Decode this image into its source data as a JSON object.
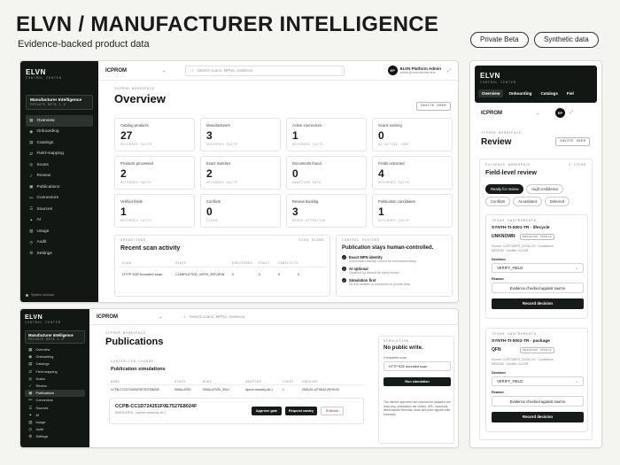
{
  "hero": {
    "title": "ELVN / MANUFACTURER INTELLIGENCE",
    "subtitle": "Evidence-backed product data",
    "pills": [
      "Private Beta",
      "Synthetic data"
    ]
  },
  "brand": {
    "name": "ELVN",
    "sub": "CONTROL CENTER"
  },
  "workspace": {
    "title": "Manufacturer Intelligence",
    "sub": "PRIVATE BETA 1.2"
  },
  "nav": [
    {
      "label": "Overview",
      "icon": "▦"
    },
    {
      "label": "Onboarding",
      "icon": "◉"
    },
    {
      "label": "Catalogs",
      "icon": "▤"
    },
    {
      "label": "Field-mapping",
      "icon": "⇄"
    },
    {
      "label": "Scans",
      "icon": "◎"
    },
    {
      "label": "Review",
      "icon": "✓"
    },
    {
      "label": "Publications",
      "icon": "▣"
    },
    {
      "label": "Connectors",
      "icon": "⚯"
    },
    {
      "label": "Sources",
      "icon": "☰"
    },
    {
      "label": "AI",
      "icon": "✦"
    },
    {
      "label": "Usage",
      "icon": "▥"
    },
    {
      "label": "Audit",
      "icon": "◷"
    },
    {
      "label": "Settings",
      "icon": "⚙"
    }
  ],
  "footer": {
    "status": "System nominal"
  },
  "topbar": {
    "workspace": "ICPROM",
    "search_placeholder": "Search scans, MPNs, evidence",
    "user_initials": "EP",
    "user_name": "ELVN Platform Admin",
    "user_email": "admin@controlcenter.test"
  },
  "overview": {
    "eyebrow": "ICPROM WORKSPACE",
    "title": "Overview",
    "action": "INVITE USER",
    "cards": [
      {
        "label": "Catalog products",
        "value": "27",
        "meta": "RECORDED FACTS"
      },
      {
        "label": "Manufacturers",
        "value": "3",
        "meta": "RECORDED FACTS"
      },
      {
        "label": "Active connectors",
        "value": "1",
        "meta": "RECORDED FACTS"
      },
      {
        "label": "Scans running",
        "value": "0",
        "meta": "NO ACTIVE JOBS"
      },
      {
        "label": "Products processed",
        "value": "2",
        "meta": "RECORDED FACTS"
      },
      {
        "label": "Exact matches",
        "value": "2",
        "meta": "RECORDED FACTS"
      },
      {
        "label": "Documents found",
        "value": "0",
        "meta": "AWAITING DATA"
      },
      {
        "label": "Fields extracted",
        "value": "4",
        "meta": "RECORDED FACTS"
      },
      {
        "label": "Verified fields",
        "value": "1",
        "meta": "RECORDED FACTS"
      },
      {
        "label": "Conflicts",
        "value": "0",
        "meta": "CLEAR"
      },
      {
        "label": "Review backlog",
        "value": "3",
        "meta": "NEEDS ATTENTION"
      },
      {
        "label": "Publication candidates",
        "value": "1",
        "meta": "RECORDED FACTS"
      }
    ],
    "ops": {
      "eyebrow": "OPERATIONS",
      "title": "Recent scan activity",
      "action": "VIEW SCANS",
      "headers": [
        "SCAN",
        "STATE",
        "PROCESSED",
        "EXACT",
        "CONFLICTS"
      ],
      "row": [
        "HTTP E2E bounded scan",
        "COMPLETED_WITH_REVIEW",
        "2",
        "2",
        "0",
        "2"
      ]
    },
    "control": {
      "eyebrow": "CONTROL POSTURE",
      "title": "Publication stays human-controlled.",
      "items": [
        {
          "title": "Exact MPN identity",
          "desc": "Unbounded identity cannot be normalized away."
        },
        {
          "title": "AI optional",
          "desc": "Disabled by default for every tenant."
        },
        {
          "title": "Simulation first",
          "desc": "No live adapter is connected in private beta."
        }
      ]
    }
  },
  "publications": {
    "eyebrow": "ICPROM WORKSPACE",
    "title": "Publications",
    "sim": {
      "eyebrow": "CONTROLLED CHANGE",
      "title": "Publication simulations",
      "headers": [
        "NAME",
        "STATE",
        "MODE",
        "ADAPTER",
        "COUNT",
        "CREATED"
      ],
      "row": [
        "CCPB-CC1D724251F0E7527E8024F",
        "SIMULATED",
        "SIMULATION_ONLY",
        "icprom-readonly-sit-1",
        "1",
        "2026-05-12T08:42:28+00:00"
      ],
      "detail_name": "CCPB-CC1D724251F0E7527E8024F",
      "detail_sub": "SIMULATED · icprom-readonly-sit-1",
      "approve": "Approve gate",
      "canary": "Request canary",
      "rollback": "Rollback"
    },
    "side": {
      "eyebrow": "SIMULATION",
      "title": "No public write.",
      "label": "Completed scan",
      "scan": "HTTP E2E bounded scan",
      "run": "Run simulation",
      "note": "Two distinct approvers are required for adapters are read-only, simulations are closed. URL, canonical, title/template formulas, stock and price signals write boundary."
    }
  },
  "mobile": {
    "tabs": [
      "Overview",
      "Onboarding",
      "Catalogs",
      "Fiel"
    ],
    "eyebrow": "ICPROM WORKSPACE",
    "title": "Review",
    "action": "INVITE USER",
    "section_eyebrow": "EVIDENCE WORKSPACE",
    "section_count": "3 ITEMS",
    "section_title": "Field-level review",
    "filters": [
      "Ready for review",
      "High confidence",
      "Conflicts",
      "AI-assisted",
      "Deferred"
    ],
    "items": [
      {
        "vendor": "TEXAS INSTRUMENTS",
        "mpn": "SYNTH-TI-0001-TR · lifecycle",
        "status": "UNKNOWN",
        "badge": "OBSERVED_SOURCE",
        "meta1": "Source: CUSTOMER_CATALOG · Confidence",
        "meta2": "MEDIUM · Conflict: CLEAR",
        "decision_label": "Decision",
        "decision": "VERIFY_FIELD",
        "reason_label": "Reason",
        "reason": "Evidence checked against source",
        "record": "Record decision"
      },
      {
        "vendor": "TEXAS INSTRUMENTS",
        "mpn": "SYNTH-TI-0002-TR · package",
        "status": "QFN",
        "badge": "OBSERVED_SOURCE",
        "meta1": "Source: CUSTOMER_CATALOG · Confidence",
        "meta2": "MEDIUM · Conflict: CLEAR",
        "decision_label": "Decision",
        "decision": "VERIFY_FIELD",
        "reason_label": "Reason",
        "reason": "Evidence checked against source",
        "record": "Record decision"
      }
    ]
  },
  "colors": {
    "sidebar": "#121714",
    "accent_dark": "#161b18",
    "canvas": "#f4f4f1"
  }
}
